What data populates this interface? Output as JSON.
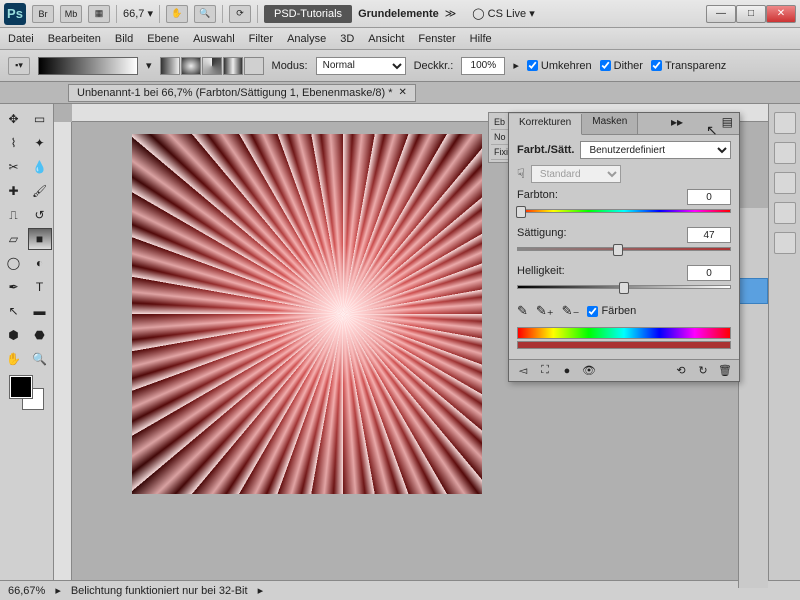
{
  "titlebar": {
    "zoom": "66,7",
    "button_psd_tutorials": "PSD-Tutorials",
    "button_grundelemente": "Grundelemente",
    "cs_live": "CS Live"
  },
  "menu": [
    "Datei",
    "Bearbeiten",
    "Bild",
    "Ebene",
    "Auswahl",
    "Filter",
    "Analyse",
    "3D",
    "Ansicht",
    "Fenster",
    "Hilfe"
  ],
  "options": {
    "modus_label": "Modus:",
    "modus_value": "Normal",
    "deckkr_label": "Deckkr.:",
    "deckkr_value": "100%",
    "umkehren": "Umkehren",
    "dither": "Dither",
    "transparenz": "Transparenz"
  },
  "doctab": {
    "title": "Unbenannt-1 bei 66,7% (Farbton/Sättigung 1, Ebenenmaske/8) *"
  },
  "layers_edge": {
    "tab_eb": "Eb",
    "norm": "No",
    "fix": "Fixi"
  },
  "panel": {
    "tab_korrekturen": "Korrekturen",
    "tab_masken": "Masken",
    "title": "Farbt./Sätt.",
    "preset": "Benutzerdefiniert",
    "range": "Standard",
    "hue_label": "Farbton:",
    "hue_value": "0",
    "sat_label": "Sättigung:",
    "sat_value": "47",
    "light_label": "Helligkeit:",
    "light_value": "0",
    "colorize": "Färben"
  },
  "status": {
    "zoom": "66,67%",
    "msg": "Belichtung funktioniert nur bei 32-Bit"
  }
}
